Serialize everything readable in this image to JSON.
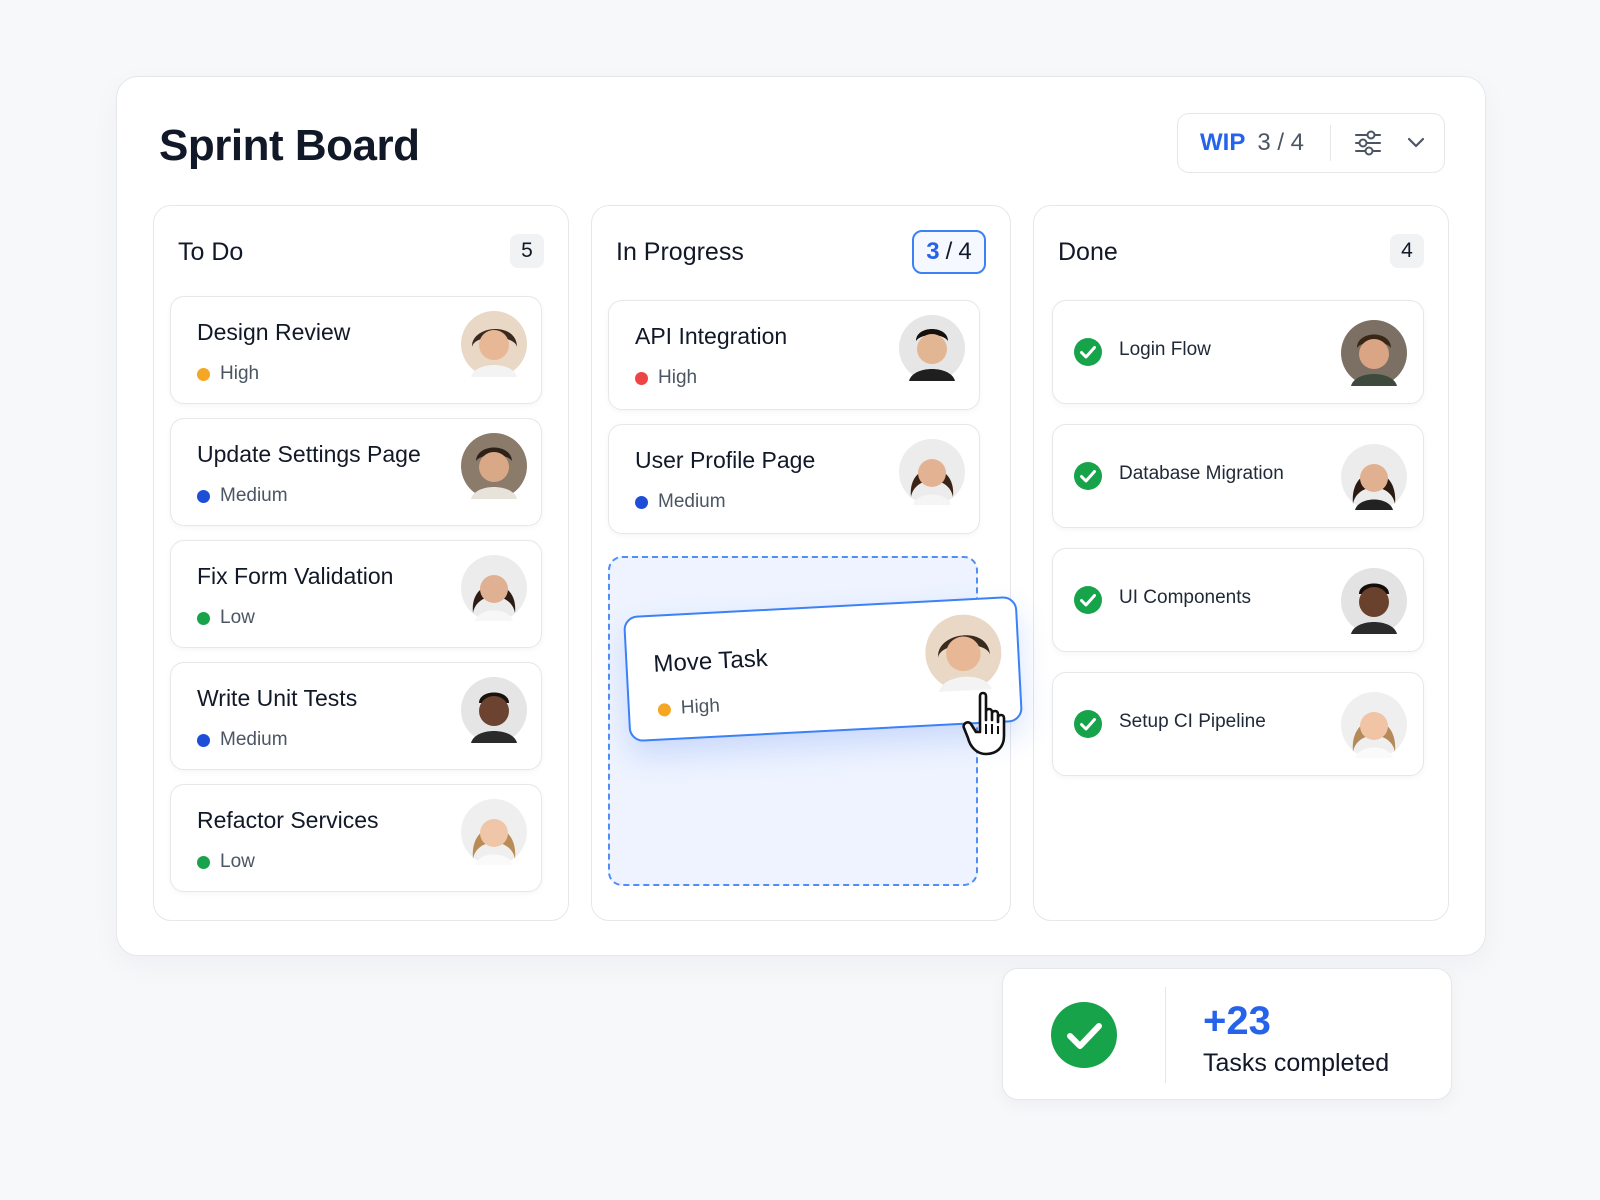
{
  "board": {
    "title": "Sprint Board",
    "wip": {
      "label": "WIP",
      "value": "3 / 4"
    },
    "controls": {
      "filter_icon": "sliders-icon",
      "dropdown_icon": "chevron-down-icon"
    }
  },
  "columns": {
    "todo": {
      "title": "To Do",
      "count": "5",
      "cards": [
        {
          "title": "Design Review",
          "priority": "High",
          "priority_color": "#f5a623"
        },
        {
          "title": "Update Settings Page",
          "priority": "Medium",
          "priority_color": "#1d4ed8"
        },
        {
          "title": "Fix Form Validation",
          "priority": "Low",
          "priority_color": "#16a34a"
        },
        {
          "title": "Write Unit Tests",
          "priority": "Medium",
          "priority_color": "#1d4ed8"
        },
        {
          "title": "Refactor Services",
          "priority": "Low",
          "priority_color": "#16a34a"
        }
      ]
    },
    "in_progress": {
      "title": "In Progress",
      "wip_current": "3",
      "wip_separator": "/",
      "wip_max": "4",
      "cards": [
        {
          "title": "API Integration",
          "priority": "High",
          "priority_color": "#ef4444"
        },
        {
          "title": "User Profile Page",
          "priority": "Medium",
          "priority_color": "#1d4ed8"
        }
      ]
    },
    "done": {
      "title": "Done",
      "count": "4",
      "cards": [
        {
          "title": "Login Flow"
        },
        {
          "title": "Database Migration"
        },
        {
          "title": "UI Components"
        },
        {
          "title": "Setup CI Pipeline"
        }
      ]
    }
  },
  "dragging_card": {
    "title": "Move Task",
    "priority": "High",
    "priority_color": "#f5a623"
  },
  "stat": {
    "value": "+23",
    "label": "Tasks completed"
  },
  "colors": {
    "accent": "#2563eb",
    "success": "#16a34a",
    "border": "#e5e7eb"
  }
}
